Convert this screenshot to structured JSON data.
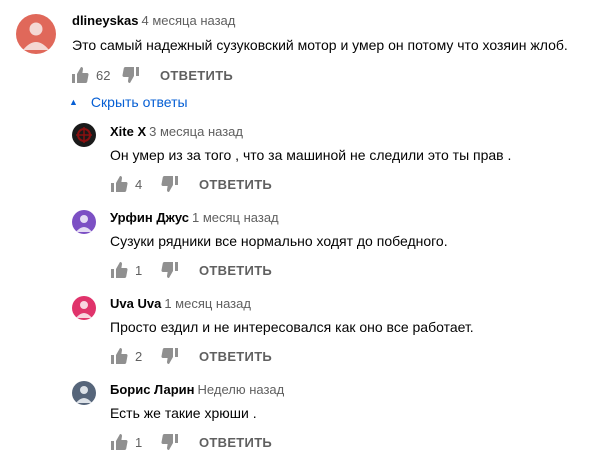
{
  "main_comment": {
    "author": "dlineyskas",
    "time": "4 месяца назад",
    "text": "Это самый надежный сузуковский мотор и умер он потому что хозяин жлоб.",
    "likes": "62",
    "reply_label": "ОТВЕТИТЬ",
    "avatar_color": "#e0685a"
  },
  "replies_toggle": {
    "icon": "chevron-up-icon",
    "label": "Скрыть ответы"
  },
  "replies": [
    {
      "author": "Xite X",
      "time": "3 месяца назад",
      "text": "Он умер из за того , что за машиной не следили это ты прав .",
      "likes": "4",
      "reply_label": "ОТВЕТИТЬ",
      "avatar_color": "#1a1a1a"
    },
    {
      "author": "Урфин Джус",
      "time": "1 месяц назад",
      "text": "Сузуки рядники все нормально ходят до победного.",
      "likes": "1",
      "reply_label": "ОТВЕТИТЬ",
      "avatar_color": "#7c50c4"
    },
    {
      "author": "Uva Uva",
      "time": "1 месяц назад",
      "text": "Просто ездил и не интересовался как оно все работает.",
      "likes": "2",
      "reply_label": "ОТВЕТИТЬ",
      "avatar_color": "#e0336b"
    },
    {
      "author": "Борис Ларин",
      "time": "Неделю назад",
      "text": "Есть же такие хрюши .",
      "likes": "1",
      "reply_label": "ОТВЕТИТЬ",
      "avatar_color": "#56657a"
    }
  ]
}
